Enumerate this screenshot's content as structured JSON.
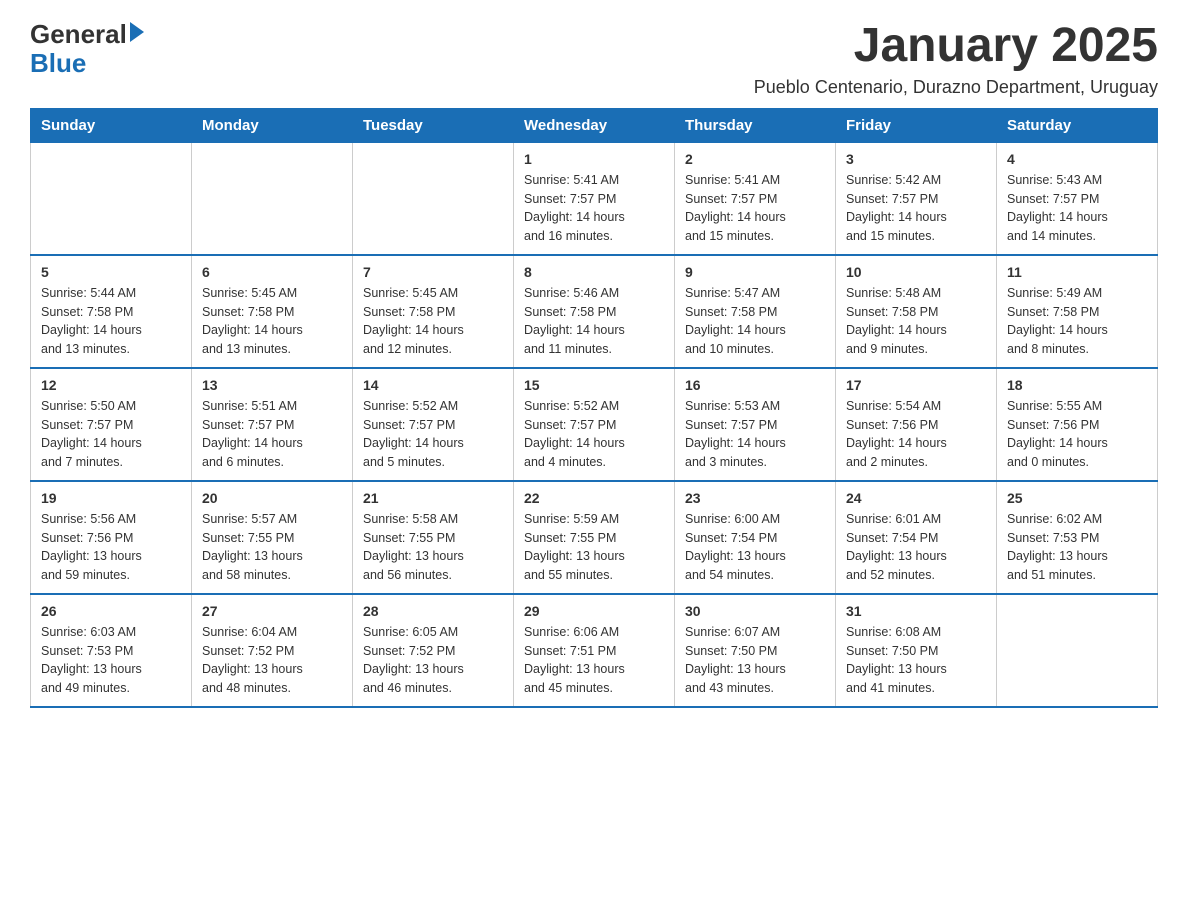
{
  "logo": {
    "general": "General",
    "blue": "Blue"
  },
  "title": "January 2025",
  "subtitle": "Pueblo Centenario, Durazno Department, Uruguay",
  "days_of_week": [
    "Sunday",
    "Monday",
    "Tuesday",
    "Wednesday",
    "Thursday",
    "Friday",
    "Saturday"
  ],
  "weeks": [
    [
      {
        "day": "",
        "info": ""
      },
      {
        "day": "",
        "info": ""
      },
      {
        "day": "",
        "info": ""
      },
      {
        "day": "1",
        "info": "Sunrise: 5:41 AM\nSunset: 7:57 PM\nDaylight: 14 hours\nand 16 minutes."
      },
      {
        "day": "2",
        "info": "Sunrise: 5:41 AM\nSunset: 7:57 PM\nDaylight: 14 hours\nand 15 minutes."
      },
      {
        "day": "3",
        "info": "Sunrise: 5:42 AM\nSunset: 7:57 PM\nDaylight: 14 hours\nand 15 minutes."
      },
      {
        "day": "4",
        "info": "Sunrise: 5:43 AM\nSunset: 7:57 PM\nDaylight: 14 hours\nand 14 minutes."
      }
    ],
    [
      {
        "day": "5",
        "info": "Sunrise: 5:44 AM\nSunset: 7:58 PM\nDaylight: 14 hours\nand 13 minutes."
      },
      {
        "day": "6",
        "info": "Sunrise: 5:45 AM\nSunset: 7:58 PM\nDaylight: 14 hours\nand 13 minutes."
      },
      {
        "day": "7",
        "info": "Sunrise: 5:45 AM\nSunset: 7:58 PM\nDaylight: 14 hours\nand 12 minutes."
      },
      {
        "day": "8",
        "info": "Sunrise: 5:46 AM\nSunset: 7:58 PM\nDaylight: 14 hours\nand 11 minutes."
      },
      {
        "day": "9",
        "info": "Sunrise: 5:47 AM\nSunset: 7:58 PM\nDaylight: 14 hours\nand 10 minutes."
      },
      {
        "day": "10",
        "info": "Sunrise: 5:48 AM\nSunset: 7:58 PM\nDaylight: 14 hours\nand 9 minutes."
      },
      {
        "day": "11",
        "info": "Sunrise: 5:49 AM\nSunset: 7:58 PM\nDaylight: 14 hours\nand 8 minutes."
      }
    ],
    [
      {
        "day": "12",
        "info": "Sunrise: 5:50 AM\nSunset: 7:57 PM\nDaylight: 14 hours\nand 7 minutes."
      },
      {
        "day": "13",
        "info": "Sunrise: 5:51 AM\nSunset: 7:57 PM\nDaylight: 14 hours\nand 6 minutes."
      },
      {
        "day": "14",
        "info": "Sunrise: 5:52 AM\nSunset: 7:57 PM\nDaylight: 14 hours\nand 5 minutes."
      },
      {
        "day": "15",
        "info": "Sunrise: 5:52 AM\nSunset: 7:57 PM\nDaylight: 14 hours\nand 4 minutes."
      },
      {
        "day": "16",
        "info": "Sunrise: 5:53 AM\nSunset: 7:57 PM\nDaylight: 14 hours\nand 3 minutes."
      },
      {
        "day": "17",
        "info": "Sunrise: 5:54 AM\nSunset: 7:56 PM\nDaylight: 14 hours\nand 2 minutes."
      },
      {
        "day": "18",
        "info": "Sunrise: 5:55 AM\nSunset: 7:56 PM\nDaylight: 14 hours\nand 0 minutes."
      }
    ],
    [
      {
        "day": "19",
        "info": "Sunrise: 5:56 AM\nSunset: 7:56 PM\nDaylight: 13 hours\nand 59 minutes."
      },
      {
        "day": "20",
        "info": "Sunrise: 5:57 AM\nSunset: 7:55 PM\nDaylight: 13 hours\nand 58 minutes."
      },
      {
        "day": "21",
        "info": "Sunrise: 5:58 AM\nSunset: 7:55 PM\nDaylight: 13 hours\nand 56 minutes."
      },
      {
        "day": "22",
        "info": "Sunrise: 5:59 AM\nSunset: 7:55 PM\nDaylight: 13 hours\nand 55 minutes."
      },
      {
        "day": "23",
        "info": "Sunrise: 6:00 AM\nSunset: 7:54 PM\nDaylight: 13 hours\nand 54 minutes."
      },
      {
        "day": "24",
        "info": "Sunrise: 6:01 AM\nSunset: 7:54 PM\nDaylight: 13 hours\nand 52 minutes."
      },
      {
        "day": "25",
        "info": "Sunrise: 6:02 AM\nSunset: 7:53 PM\nDaylight: 13 hours\nand 51 minutes."
      }
    ],
    [
      {
        "day": "26",
        "info": "Sunrise: 6:03 AM\nSunset: 7:53 PM\nDaylight: 13 hours\nand 49 minutes."
      },
      {
        "day": "27",
        "info": "Sunrise: 6:04 AM\nSunset: 7:52 PM\nDaylight: 13 hours\nand 48 minutes."
      },
      {
        "day": "28",
        "info": "Sunrise: 6:05 AM\nSunset: 7:52 PM\nDaylight: 13 hours\nand 46 minutes."
      },
      {
        "day": "29",
        "info": "Sunrise: 6:06 AM\nSunset: 7:51 PM\nDaylight: 13 hours\nand 45 minutes."
      },
      {
        "day": "30",
        "info": "Sunrise: 6:07 AM\nSunset: 7:50 PM\nDaylight: 13 hours\nand 43 minutes."
      },
      {
        "day": "31",
        "info": "Sunrise: 6:08 AM\nSunset: 7:50 PM\nDaylight: 13 hours\nand 41 minutes."
      },
      {
        "day": "",
        "info": ""
      }
    ]
  ]
}
